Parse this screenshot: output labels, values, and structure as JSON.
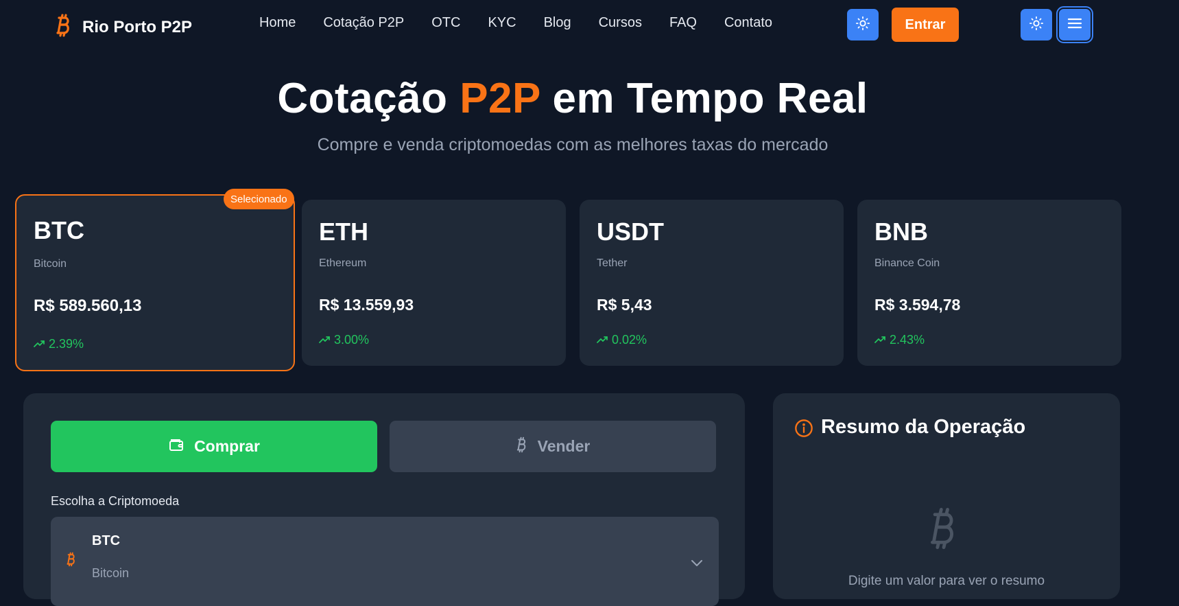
{
  "brand": {
    "name": "Rio Porto P2P",
    "accent": "#f97316"
  },
  "nav": {
    "items": [
      {
        "label": "Home"
      },
      {
        "label": "Cotação P2P"
      },
      {
        "label": "OTC"
      },
      {
        "label": "KYC"
      },
      {
        "label": "Blog"
      },
      {
        "label": "Cursos"
      },
      {
        "label": "FAQ"
      },
      {
        "label": "Contato"
      }
    ],
    "login_label": "Entrar"
  },
  "hero": {
    "title_part1": "Cotação ",
    "title_accent": "P2P",
    "title_part2": " em Tempo Real",
    "subtitle": "Compre e venda criptomoedas com as melhores taxas do mercado"
  },
  "coins": [
    {
      "symbol": "BTC",
      "name": "Bitcoin",
      "price": "R$ 589.560,13",
      "change": "2.39%",
      "selected": true,
      "badge": "Selecionado"
    },
    {
      "symbol": "ETH",
      "name": "Ethereum",
      "price": "R$ 13.559,93",
      "change": "3.00%"
    },
    {
      "symbol": "USDT",
      "name": "Tether",
      "price": "R$ 5,43",
      "change": "0.02%"
    },
    {
      "symbol": "BNB",
      "name": "Binance Coin",
      "price": "R$ 3.594,78",
      "change": "2.43%"
    }
  ],
  "trade": {
    "buy_label": "Comprar",
    "sell_label": "Vender",
    "crypto_label": "Escolha a Criptomoeda",
    "selected_symbol": "BTC",
    "selected_name": "Bitcoin"
  },
  "summary": {
    "title": "Resumo da Operação",
    "hint": "Digite um valor para ver o resumo"
  },
  "colors": {
    "buy": "#22c55e",
    "primary": "#3b82f6",
    "positive": "#22c55e"
  }
}
